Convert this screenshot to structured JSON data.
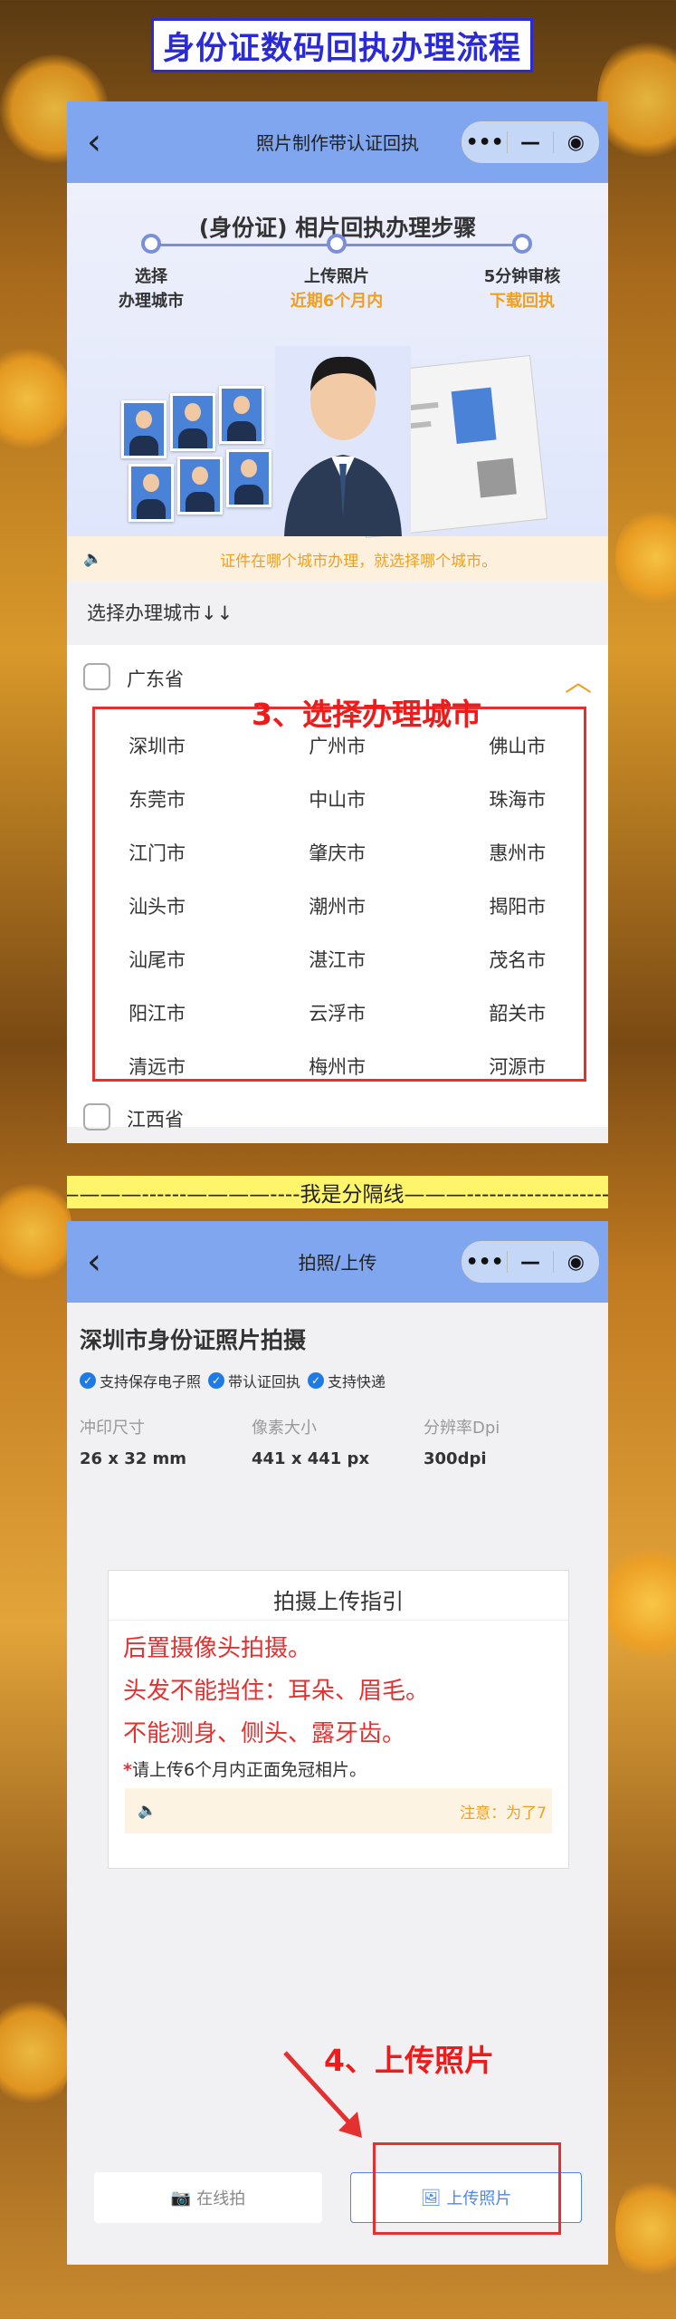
{
  "header": {
    "title": "身份证数码回执办理流程"
  },
  "screen1": {
    "nav_title": "照片制作带认证回执",
    "capsule": {
      "more": "•••",
      "min": "—",
      "close": "◉"
    },
    "steps_title": "(身份证) 相片回执办理步骤",
    "steps": [
      {
        "line1": "选择",
        "line2": "办理城市"
      },
      {
        "line1": "上传照片",
        "line2": "近期6个月内"
      },
      {
        "line1": "5分钟审核",
        "line2": "下载回执"
      }
    ],
    "notice": "证件在哪个城市办理，就选择哪个城市。",
    "select_label": "选择办理城市↓↓",
    "province": "广东省",
    "province_next": "江西省",
    "annotation": "3、选择办理城市",
    "cities": [
      [
        "深圳市",
        "广州市",
        "佛山市"
      ],
      [
        "东莞市",
        "中山市",
        "珠海市"
      ],
      [
        "江门市",
        "肇庆市",
        "惠州市"
      ],
      [
        "汕头市",
        "潮州市",
        "揭阳市"
      ],
      [
        "汕尾市",
        "湛江市",
        "茂名市"
      ],
      [
        "阳江市",
        "云浮市",
        "韶关市"
      ],
      [
        "清远市",
        "梅州市",
        "河源市"
      ]
    ]
  },
  "divider": "————------————----我是分隔线———--------------------",
  "screen2": {
    "nav_title": "拍照/上传",
    "heading": "深圳市身份证照片拍摄",
    "tags": [
      "支持保存电子照",
      "带认证回执",
      "支持快递"
    ],
    "specs": [
      {
        "label": "冲印尺寸",
        "value": "26 x 32 mm"
      },
      {
        "label": "像素大小",
        "value": "441 x 441 px"
      },
      {
        "label": "分辨率Dpi",
        "value": "300dpi"
      }
    ],
    "guide_title": "拍摄上传指引",
    "guide_lines": [
      "后置摄像头拍摄。",
      "头发不能挡住：耳朵、眉毛。",
      "不能测身、侧头、露牙齿。"
    ],
    "guide_small": "请上传6个月内正面免冠相片。",
    "guide_note": "注意：为了7",
    "annotation": "4、上传照片",
    "btn_online": "在线拍",
    "btn_upload": "上传照片"
  }
}
